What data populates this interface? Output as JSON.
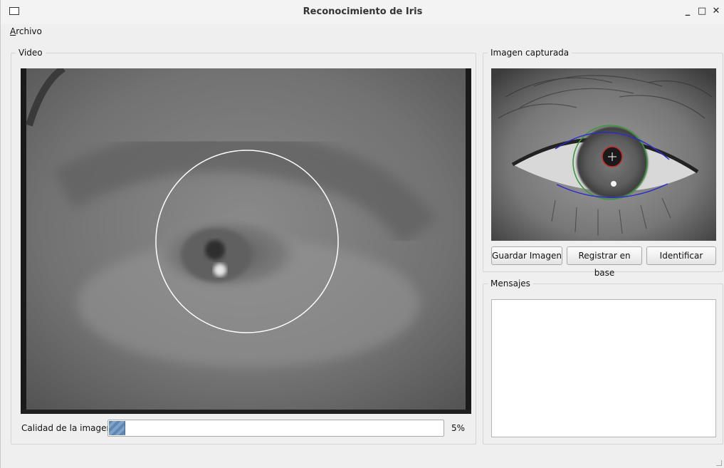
{
  "window": {
    "title": "Reconocimiento de Iris",
    "controls": {
      "minimize": "_",
      "maximize": "□",
      "close": "✕"
    }
  },
  "menu": {
    "archivo_mnemonic": "A",
    "archivo_rest": "rchivo"
  },
  "video": {
    "group_title": "Video",
    "quality_label": "Calidad de la imagen",
    "quality_value": "5%",
    "quality_fraction": 0.05
  },
  "captured": {
    "group_title": "Imagen capturada"
  },
  "buttons": {
    "save": "Guardar Imagen",
    "register": "Registrar en base",
    "identify": "Identificar"
  },
  "messages": {
    "group_title": "Mensajes",
    "content": ""
  },
  "colors": {
    "pupil_circle": "#cc2a2a",
    "iris_circle": "#3a9a3a",
    "eyelid_curve": "#2a2ad0",
    "video_circle": "#ffffff",
    "progress_fill": "#6f93bd"
  }
}
